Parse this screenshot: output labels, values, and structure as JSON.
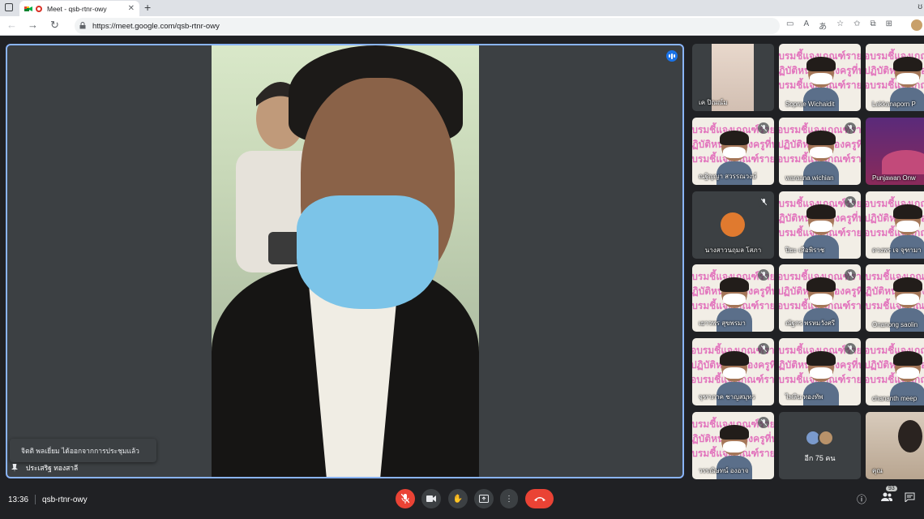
{
  "browser": {
    "tab_title": "Meet - qsb-rtnr-owy",
    "tab_close": "✕",
    "new_tab": "+",
    "url": "https://meet.google.com/qsb-rtnr-owy"
  },
  "meeting": {
    "main_speaker_name": "ประเสริฐ ทองสาลี",
    "toast_message": "จิตติ พลเยี่ยม ได้ออกจากการประชุมแล้ว",
    "time": "13:36",
    "code": "qsb-rtnr-owy",
    "participant_count": "93"
  },
  "slide_text": {
    "line1": "อบรมชี้แจงเกณฑ์รายงาน",
    "line2": "ปฏิบัติหน้าที่ของครูที่ปรึ"
  },
  "tiles": [
    {
      "name": "เค ปิณณ์ม",
      "muted": false,
      "kind": "person"
    },
    {
      "name": "Soprae Wichaidit",
      "muted": false,
      "kind": "slide"
    },
    {
      "name": "Lakkanaporn P",
      "muted": false,
      "kind": "slide"
    },
    {
      "name": "ณฐิญญา สวรรณวงษ์",
      "muted": true,
      "kind": "slide"
    },
    {
      "name": "waraana wichian",
      "muted": true,
      "kind": "slide"
    },
    {
      "name": "Punjawan Onw",
      "muted": false,
      "kind": "party"
    },
    {
      "name": "นางสาวนฤมล โสภา",
      "muted": true,
      "kind": "avatar"
    },
    {
      "name": "ปิยะ เสือพิราช",
      "muted": true,
      "kind": "slide"
    },
    {
      "name": "ดวงพร เจ จุฑามา",
      "muted": true,
      "kind": "slide"
    },
    {
      "name": "เยาวพร สุขพรมา",
      "muted": true,
      "kind": "slide"
    },
    {
      "name": "ณัฐกร พรหมวังศรี",
      "muted": true,
      "kind": "slide"
    },
    {
      "name": "Onanong saolin",
      "muted": true,
      "kind": "slide"
    },
    {
      "name": "จุฑาภาค ชาญสมุทร",
      "muted": true,
      "kind": "slide"
    },
    {
      "name": "ไพลิน ทองทัพ",
      "muted": true,
      "kind": "slide"
    },
    {
      "name": "chananth meep",
      "muted": false,
      "kind": "slide"
    },
    {
      "name": "วรรณิษทน์ องอาจ",
      "muted": true,
      "kind": "slide"
    },
    {
      "name": "อีก 75 คน",
      "muted": false,
      "kind": "more"
    },
    {
      "name": "คุณ",
      "muted": false,
      "kind": "self"
    }
  ],
  "icons": {
    "back": "←",
    "forward": "→",
    "reload": "↻",
    "lock": "🔒",
    "mic_off": "✕",
    "mic": "🎙",
    "camera": "■",
    "hand": "✋",
    "present": "⬆",
    "more": "⋮",
    "hangup": "☎",
    "info": "ⓘ",
    "people": "👥",
    "chat": "💬"
  }
}
